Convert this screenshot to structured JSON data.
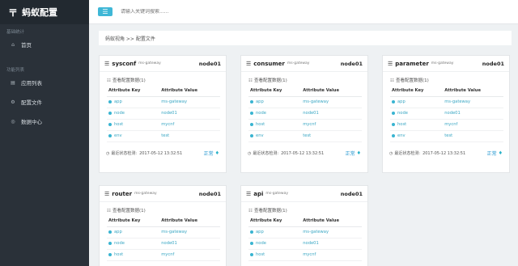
{
  "app": {
    "title": "蚂蚁配置",
    "logo_icon": "app-logo-icon"
  },
  "sidebar": {
    "section1": "基础统计",
    "section2": "功能列表",
    "items": [
      {
        "label": "首页",
        "icon": "home-icon"
      },
      {
        "label": "应用列表",
        "icon": "list-icon"
      },
      {
        "label": "配置文件",
        "icon": "config-icon"
      },
      {
        "label": "数据中心",
        "icon": "globe-icon"
      }
    ]
  },
  "topbar": {
    "menu_icon": "hamburger-icon",
    "search_placeholder": "请输入关键词搜索......"
  },
  "breadcrumb": "蚂蚁视角 >> 配置文件",
  "cards_common": {
    "view_link": "查看配置数据(1)",
    "col_key": "Attribute Key",
    "col_value": "Attribute Value",
    "status_label": "最近状态检测:",
    "status_ok": "正常",
    "accent": "#39b4d1"
  },
  "cards": [
    {
      "name": "sysconf",
      "group": "ms-gateway",
      "node": "node01",
      "time": "2017-05-12 13:32:51",
      "rows": [
        [
          "app",
          "ms-gateway"
        ],
        [
          "node",
          "node01"
        ],
        [
          "host",
          "mycnf"
        ],
        [
          "env",
          "test"
        ]
      ]
    },
    {
      "name": "consumer",
      "group": "ms-gateway",
      "node": "node01",
      "time": "2017-05-12 13:32:51",
      "rows": [
        [
          "app",
          "ms-gateway"
        ],
        [
          "node",
          "node01"
        ],
        [
          "host",
          "mycnf"
        ],
        [
          "env",
          "test"
        ]
      ]
    },
    {
      "name": "parameter",
      "group": "ms-gateway",
      "node": "node01",
      "time": "2017-05-12 13:32:51",
      "rows": [
        [
          "app",
          "ms-gateway"
        ],
        [
          "node",
          "node01"
        ],
        [
          "host",
          "mycnf"
        ],
        [
          "env",
          "test"
        ]
      ]
    },
    {
      "name": "router",
      "group": "ms-gateway",
      "node": "node01",
      "rows": [
        [
          "app",
          "ms-gateway"
        ],
        [
          "node",
          "node01"
        ],
        [
          "host",
          "mycnf"
        ]
      ]
    },
    {
      "name": "api",
      "group": "ms-gateway",
      "node": "node01",
      "rows": [
        [
          "app",
          "ms-gateway"
        ],
        [
          "node",
          "node01"
        ],
        [
          "host",
          "mycnf"
        ]
      ]
    }
  ]
}
